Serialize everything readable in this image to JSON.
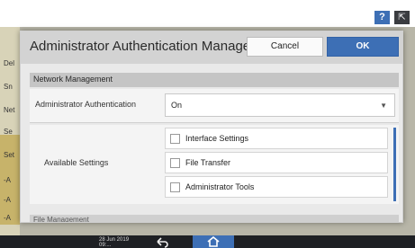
{
  "top_bar": {
    "help_label": "?",
    "expand_label": "⇱"
  },
  "background": {
    "left_labels": [
      "Del",
      "Sn",
      "Net",
      "Se",
      "Set",
      "-A",
      "-A",
      "-A"
    ]
  },
  "dialog": {
    "title": "Administrator Authentication Management",
    "cancel_label": "Cancel",
    "ok_label": "OK",
    "section_label": "Network Management",
    "auth_label": "Administrator Authentication",
    "auth_value": "On",
    "available_label": "Available Settings",
    "available_items": [
      "Interface Settings",
      "File Transfer",
      "Administrator Tools"
    ],
    "next_section_label": "File Management"
  },
  "bottom_bar": {
    "date": "28 Jun 2019",
    "time": "09:..."
  },
  "colors": {
    "accent": "#3d6fb5"
  }
}
